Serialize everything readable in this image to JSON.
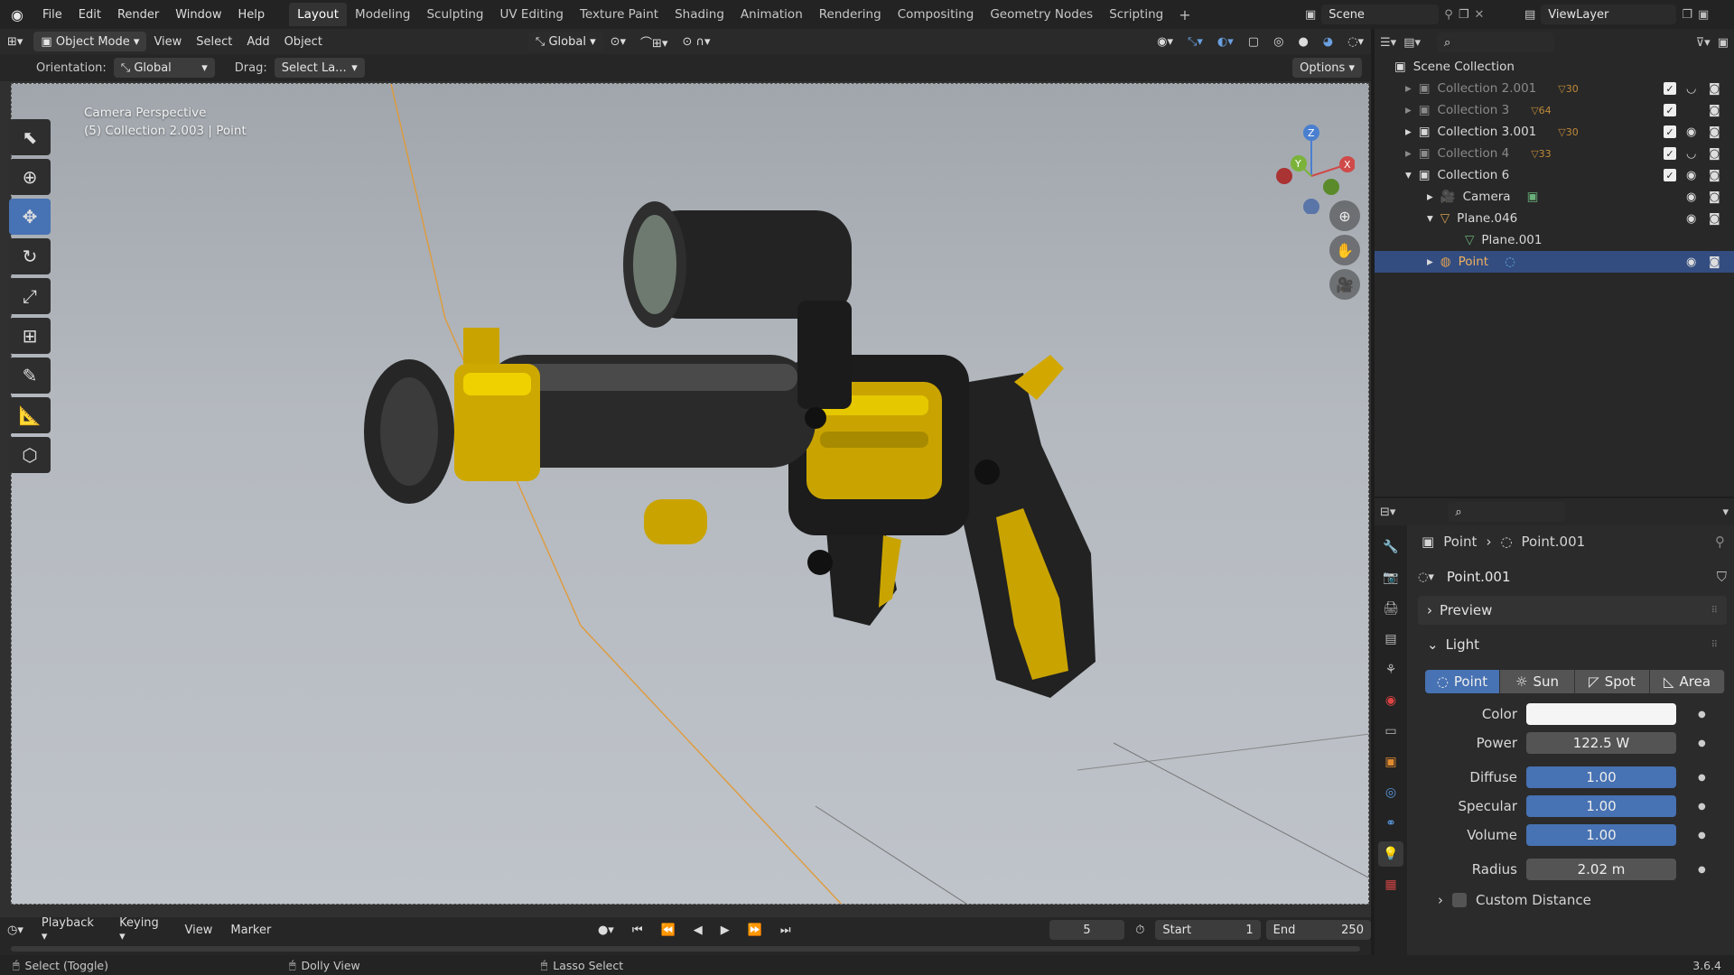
{
  "menu": {
    "items": [
      "File",
      "Edit",
      "Render",
      "Window",
      "Help"
    ]
  },
  "workspaces": {
    "tabs": [
      "Layout",
      "Modeling",
      "Sculpting",
      "UV Editing",
      "Texture Paint",
      "Shading",
      "Animation",
      "Rendering",
      "Compositing",
      "Geometry Nodes",
      "Scripting"
    ],
    "active": "Layout"
  },
  "scene": {
    "name": "Scene",
    "view_layer": "ViewLayer"
  },
  "viewport_header": {
    "mode": "Object Mode",
    "menus": [
      "View",
      "Select",
      "Add",
      "Object"
    ],
    "transform_orientation": "Global",
    "orientation_label": "Orientation:",
    "orientation_value": "Global",
    "drag_label": "Drag:",
    "drag_value": "Select La...",
    "options": "Options"
  },
  "viewport_overlay": {
    "line1": "Camera Perspective",
    "line2": "(5) Collection 2.003 | Point"
  },
  "gizmo": {
    "x": "X",
    "y": "Y",
    "z": "Z"
  },
  "timeline": {
    "menus": [
      "Playback",
      "Keying",
      "View",
      "Marker"
    ],
    "current_frame": "5",
    "start_label": "Start",
    "start": "1",
    "end_label": "End",
    "end": "250"
  },
  "status": {
    "left": "Select (Toggle)",
    "middle": "Dolly View",
    "right": "Lasso Select",
    "version": "3.6.4"
  },
  "outliner": {
    "root": "Scene Collection",
    "rows": [
      {
        "name": "Collection 2.001",
        "badge": "30",
        "dim": true
      },
      {
        "name": "Collection 3",
        "badge": "64",
        "dim": true
      },
      {
        "name": "Collection 3.001",
        "badge": "30",
        "dim": false
      },
      {
        "name": "Collection 4",
        "badge": "33",
        "dim": true
      },
      {
        "name": "Collection 6",
        "badge": "",
        "dim": false
      },
      {
        "name": "Camera",
        "badge": "",
        "dim": false
      },
      {
        "name": "Plane.046",
        "badge": "",
        "dim": false
      },
      {
        "name": "Plane.001",
        "badge": "",
        "dim": false
      },
      {
        "name": "Point",
        "badge": "",
        "dim": false
      }
    ]
  },
  "properties": {
    "breadcrumb_object": "Point",
    "breadcrumb_data": "Point.001",
    "datablock": "Point.001",
    "preview_panel": "Preview",
    "light_panel": "Light",
    "light_types": [
      "Point",
      "Sun",
      "Spot",
      "Area"
    ],
    "active_type": "Point",
    "color_label": "Color",
    "power_label": "Power",
    "power": "122.5 W",
    "diffuse_label": "Diffuse",
    "diffuse": "1.00",
    "specular_label": "Specular",
    "specular": "1.00",
    "volume_label": "Volume",
    "volume": "1.00",
    "radius_label": "Radius",
    "radius": "2.02 m",
    "custom_distance": "Custom Distance"
  }
}
